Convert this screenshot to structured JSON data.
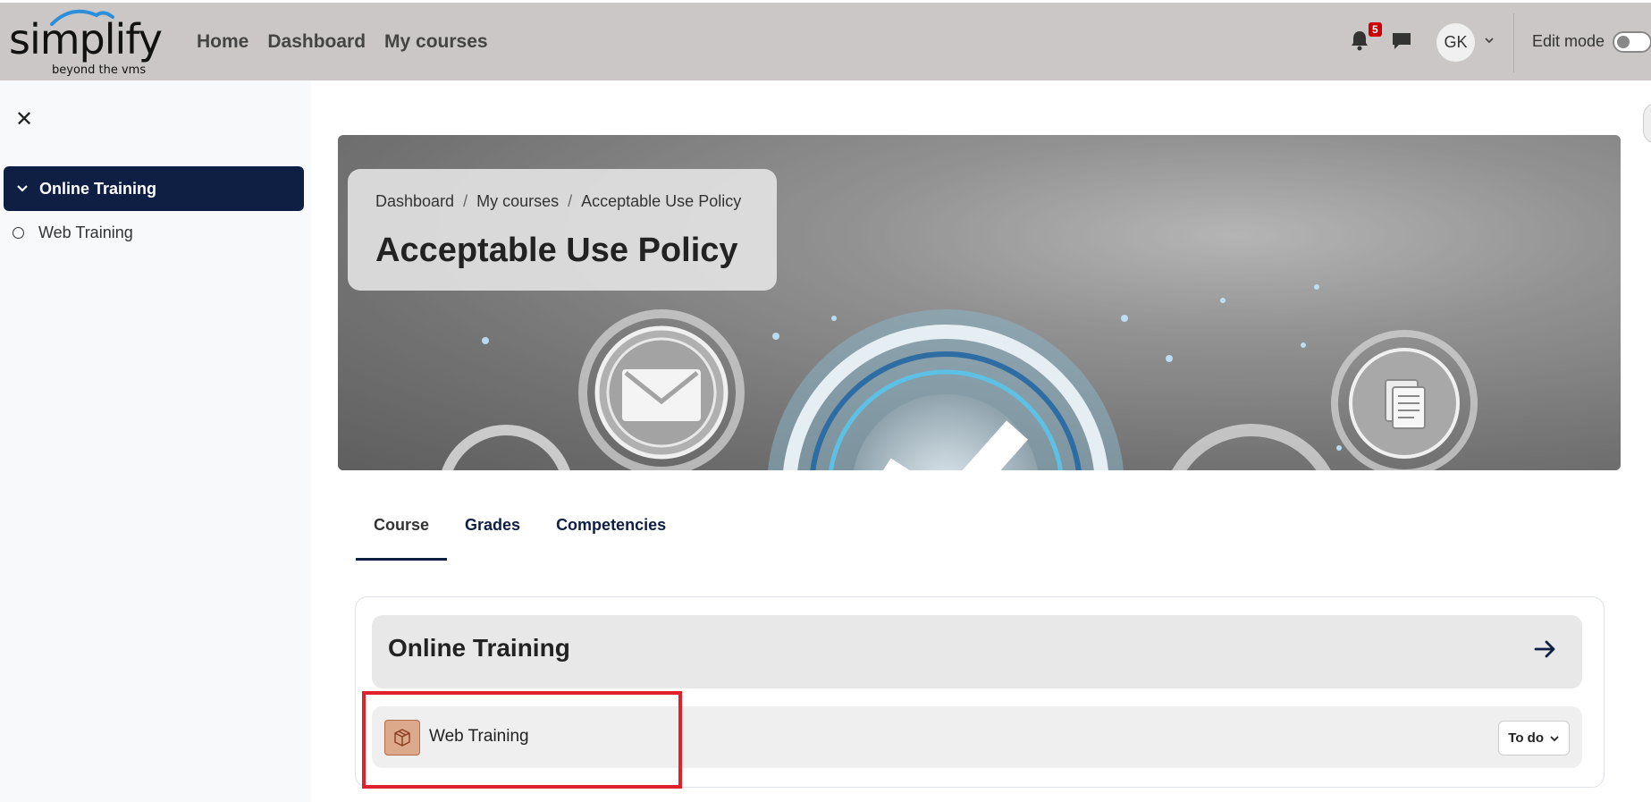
{
  "brand": {
    "name": "simplify",
    "tagline": "beyond the vms"
  },
  "nav": {
    "links": [
      {
        "label": "Home"
      },
      {
        "label": "Dashboard"
      },
      {
        "label": "My courses"
      }
    ],
    "notification_count": "5",
    "avatar_initials": "GK",
    "edit_mode_label": "Edit mode"
  },
  "sidebar": {
    "section_label": "Online Training",
    "items": [
      {
        "label": "Web Training"
      }
    ]
  },
  "header": {
    "breadcrumb": [
      {
        "label": "Dashboard"
      },
      {
        "label": "My courses"
      },
      {
        "label": "Acceptable Use Policy"
      }
    ],
    "breadcrumb_sep": "/",
    "title": "Acceptable Use Policy"
  },
  "tabs": [
    {
      "label": "Course"
    },
    {
      "label": "Grades"
    },
    {
      "label": "Competencies"
    }
  ],
  "course": {
    "section_title": "Online Training",
    "activity": {
      "name": "Web Training",
      "status_label": "To do"
    }
  }
}
